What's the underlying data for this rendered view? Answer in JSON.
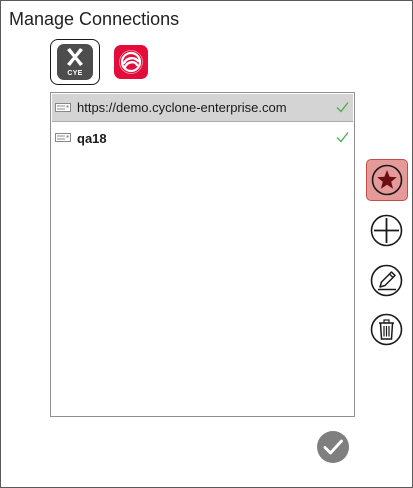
{
  "window": {
    "title": "Manage Connections"
  },
  "apps": [
    {
      "name": "cye-app-icon",
      "label": "CYE"
    },
    {
      "name": "red-app-icon"
    }
  ],
  "connections": [
    {
      "name": "https://demo.cyclone-enterprise.com",
      "selected": true,
      "bold": false,
      "status": "ok"
    },
    {
      "name": "qa18",
      "selected": false,
      "bold": true,
      "status": "ok"
    }
  ],
  "side_actions": [
    "favorite-icon",
    "add-icon",
    "edit-icon",
    "delete-icon"
  ],
  "colors": {
    "accent_red": "#e30c3b",
    "favorite_bg": "#e59a9a",
    "favorite_star": "#6b0f15",
    "check_green": "#4caf50",
    "selected_row": "#d4d4d4"
  }
}
